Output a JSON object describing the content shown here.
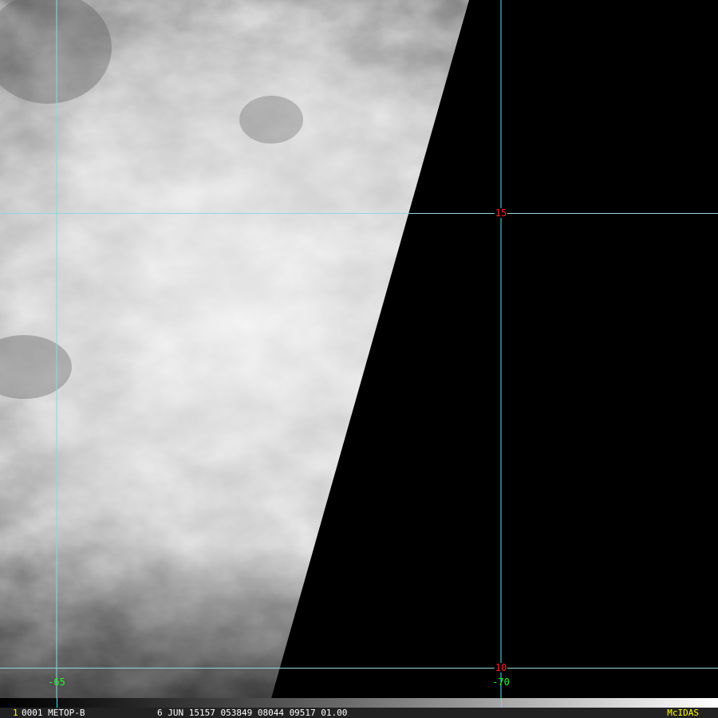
{
  "image": {
    "product": "METOP-B visible satellite image",
    "grid_color": "#5fe8f0"
  },
  "grid": {
    "latitudes": [
      {
        "label": "15"
      },
      {
        "label": "10"
      }
    ],
    "longitudes": [
      {
        "label": "-65"
      },
      {
        "label": "-70"
      }
    ]
  },
  "status_bar": {
    "frame": "1",
    "satellite": "0001 METOP-B",
    "info": "6 JUN 15157 053849 08044 09517 01.00",
    "brand": "McIDAS"
  },
  "colors": {
    "lat_label": "#ff2020",
    "lon_label": "#20ff20",
    "brand": "#ffff00"
  }
}
